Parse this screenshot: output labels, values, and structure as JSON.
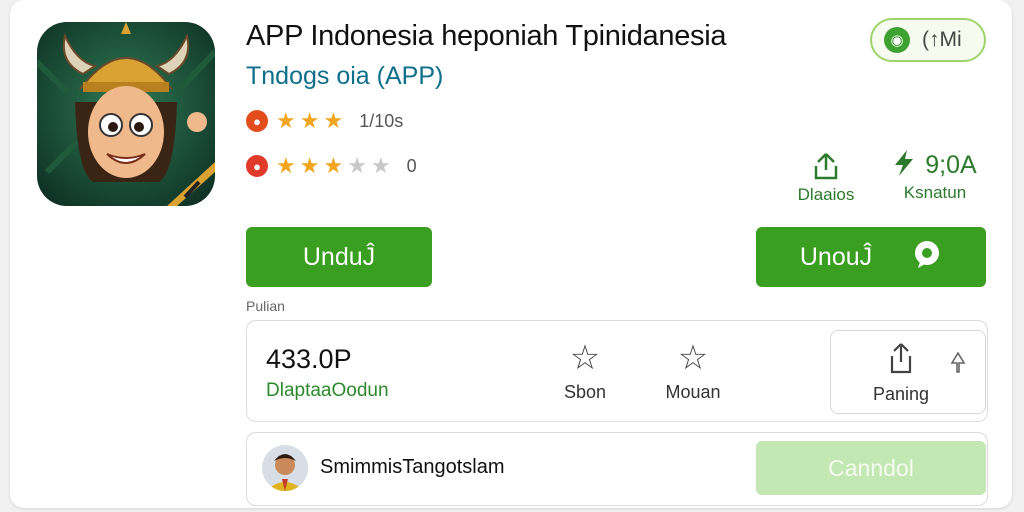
{
  "app": {
    "title": "APP Indonesia heponiah Tpinidanesia",
    "subtitle": "Tndogs oia (APP)",
    "badge_text": "(↑Mi",
    "badge_icon": "chat-icon"
  },
  "ratings": [
    {
      "badge_icon": "apple-icon",
      "badge_color": "#e34d1c",
      "stars": 2.5,
      "max": 3,
      "text": "1/10s"
    },
    {
      "badge_icon": "shield-icon",
      "badge_color": "#e03a2a",
      "stars": 2.5,
      "max": 5,
      "text": "0"
    }
  ],
  "stats": {
    "downloads_label": "Dlaaios",
    "downloads_icon": "share-up-icon",
    "size_value": "9;0A",
    "size_label": "Ksnatun",
    "size_icon": "flash-icon"
  },
  "buttons": {
    "primary_label": "UnduĴ",
    "secondary_label": "UnouĴ",
    "secondary_icon": "chat-bubble-icon"
  },
  "section": {
    "label": "Pulian"
  },
  "info": {
    "number": "433.0P",
    "number_label": "DlaptaaOodun",
    "actions": [
      {
        "label": "Sbon",
        "icon": "star-icon"
      },
      {
        "label": "Mouan",
        "icon": "star-icon"
      },
      {
        "label": "Paning",
        "icon": "share-icon"
      }
    ]
  },
  "developer": {
    "name": "SmimmisTangotslam",
    "cancel_label": "Canndol"
  },
  "colors": {
    "accent": "#3a9e20",
    "subtitle": "#0e6f8a",
    "star": "#f2a51f",
    "cancel": "#c4e8b4"
  }
}
